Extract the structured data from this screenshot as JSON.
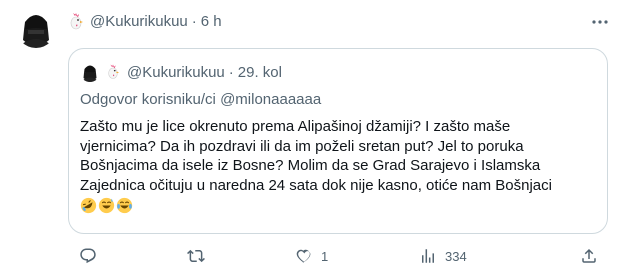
{
  "tweet": {
    "handle": "@Kukurikukuu",
    "time": "6 h",
    "separator": "·"
  },
  "quoted": {
    "handle": "@Kukurikukuu",
    "time": "29. kol",
    "separator": "·",
    "reply_prefix": "Odgovor korisniku/ci ",
    "reply_mention": "@milonaaaaaa",
    "text": "Zašto mu je lice okrenuto prema Alipašinoj džamiji? I zašto maše\nvjernicima? Da ih pozdravi ili da im poželi sretan put? Jel to poruka\nBošnjacima da isele iz Bosne? Molim da se Grad Sarajevo i Islamska\nZajednica očituju u naredna 24 sata dok nije kasno, otiće nam Bošnjaci\n",
    "emoji_names": [
      "rolling-laughing-emoji",
      "sweat-smile-emoji",
      "tears-of-joy-emoji"
    ]
  },
  "actions": {
    "reply_count": "",
    "retweet_count": "",
    "like_count": "1",
    "views_count": "334"
  },
  "icons": [
    "more-icon",
    "reply-icon",
    "retweet-icon",
    "like-icon",
    "views-icon",
    "share-icon",
    "chicken-icon"
  ],
  "colors": {
    "muted": "#536471",
    "border": "#cfd9de",
    "text": "#0f1419"
  }
}
